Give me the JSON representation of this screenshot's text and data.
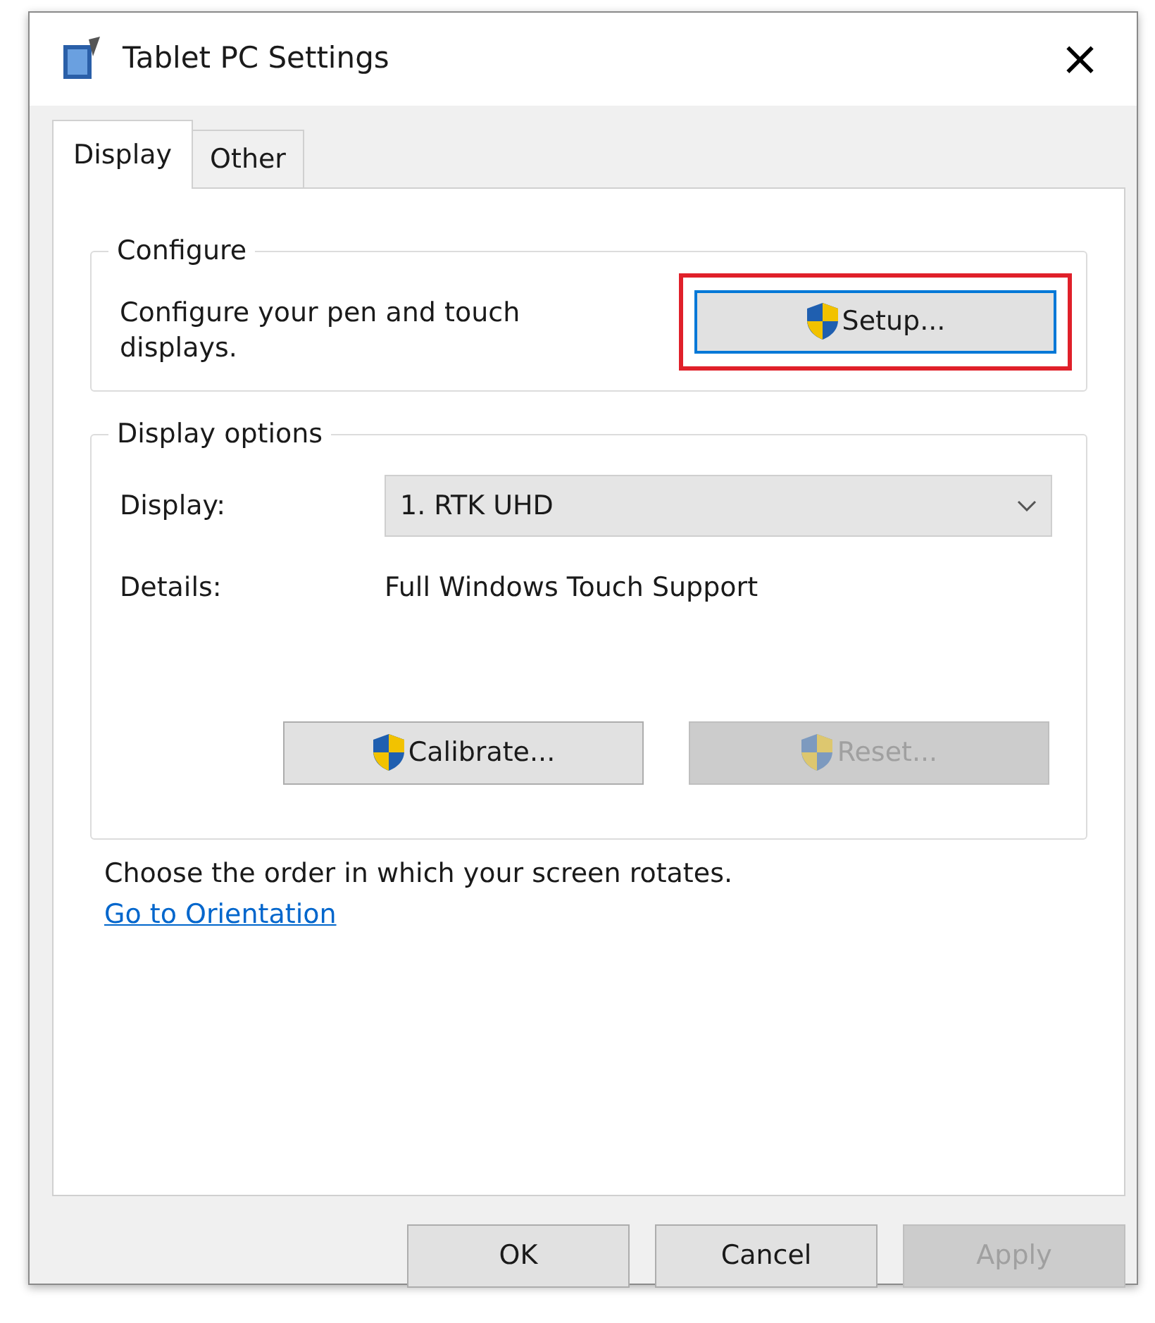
{
  "window": {
    "title": "Tablet PC Settings",
    "close": "×"
  },
  "tabs": [
    {
      "label": "Display",
      "selected": true
    },
    {
      "label": "Other",
      "selected": false
    }
  ],
  "configure": {
    "title": "Configure",
    "description": "Configure your pen and touch displays.",
    "setup_button": {
      "label": "Setup...",
      "focused": true,
      "highlighted": true,
      "shield": true
    }
  },
  "display_options": {
    "title": "Display options",
    "display_label": "Display:",
    "display_value": "1. RTK UHD",
    "details_label": "Details:",
    "details_value": "Full Windows Touch Support",
    "buttons": [
      {
        "label": "Calibrate...",
        "disabled": false,
        "shield": true
      },
      {
        "label": "Reset...",
        "disabled": true,
        "shield": true
      }
    ]
  },
  "orientation": {
    "text": "Choose the order in which your screen rotates.",
    "link": "Go to Orientation"
  },
  "footer_buttons": [
    {
      "label": "OK",
      "disabled": false
    },
    {
      "label": "Cancel",
      "disabled": false
    },
    {
      "label": "Apply",
      "disabled": true
    }
  ]
}
